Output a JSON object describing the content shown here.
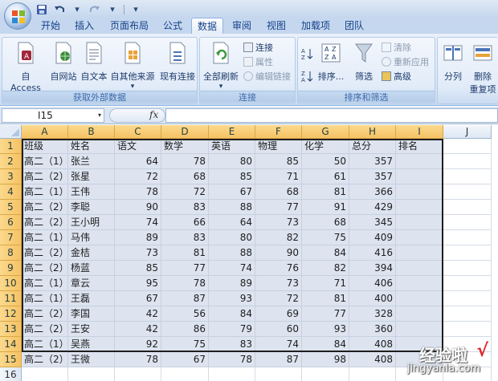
{
  "quick_access": {
    "separator": "|",
    "dropdown": "▾"
  },
  "tabs": [
    {
      "label": "开始",
      "active": false
    },
    {
      "label": "插入",
      "active": false
    },
    {
      "label": "页面布局",
      "active": false
    },
    {
      "label": "公式",
      "active": false
    },
    {
      "label": "数据",
      "active": true
    },
    {
      "label": "审阅",
      "active": false
    },
    {
      "label": "视图",
      "active": false
    },
    {
      "label": "加载项",
      "active": false
    },
    {
      "label": "团队",
      "active": false
    }
  ],
  "ribbon": {
    "external_group": {
      "label": "获取外部数据",
      "buttons": [
        "自 Access",
        "自网站",
        "自文本",
        "自其他来源",
        "现有连接"
      ]
    },
    "connections_group": {
      "label": "连接",
      "refresh": "全部刷新",
      "connections": "连接",
      "properties": "属性",
      "edit_links": "编辑链接"
    },
    "sort_group": {
      "label": "排序和筛选",
      "sort": "排序...",
      "filter": "筛选",
      "clear": "清除",
      "reapply": "重新应用",
      "advanced": "高级"
    },
    "tools_group": {
      "split": "分列",
      "remove_dup_1": "删除",
      "remove_dup_2": "重复项"
    }
  },
  "formula_bar": {
    "name_box": "I15",
    "fx": "fx",
    "content": ""
  },
  "sheet": {
    "columns": [
      "A",
      "B",
      "C",
      "D",
      "E",
      "F",
      "G",
      "H",
      "I",
      "J"
    ],
    "rows": [
      "1",
      "2",
      "3",
      "4",
      "5",
      "6",
      "7",
      "8",
      "9",
      "10",
      "11",
      "12",
      "13",
      "14",
      "15",
      "16"
    ],
    "headers": [
      "班级",
      "姓名",
      "语文",
      "数学",
      "英语",
      "物理",
      "化学",
      "总分",
      "排名"
    ],
    "records": [
      [
        "高二（1）",
        "张兰",
        "64",
        "78",
        "80",
        "85",
        "50",
        "357",
        ""
      ],
      [
        "高二（2）",
        "张星",
        "72",
        "68",
        "85",
        "71",
        "61",
        "357",
        ""
      ],
      [
        "高二（1）",
        "王伟",
        "78",
        "72",
        "67",
        "68",
        "81",
        "366",
        ""
      ],
      [
        "高二（2）",
        "李聪",
        "90",
        "83",
        "88",
        "77",
        "91",
        "429",
        ""
      ],
      [
        "高二（2）",
        "王小明",
        "74",
        "66",
        "64",
        "73",
        "68",
        "345",
        ""
      ],
      [
        "高二（1）",
        "马伟",
        "89",
        "83",
        "80",
        "82",
        "75",
        "409",
        ""
      ],
      [
        "高二（2）",
        "金桔",
        "73",
        "81",
        "88",
        "90",
        "84",
        "416",
        ""
      ],
      [
        "高二（2）",
        "杨蓝",
        "85",
        "77",
        "74",
        "76",
        "82",
        "394",
        ""
      ],
      [
        "高二（1）",
        "章云",
        "95",
        "78",
        "89",
        "73",
        "71",
        "406",
        ""
      ],
      [
        "高二（1）",
        "王磊",
        "67",
        "87",
        "93",
        "72",
        "81",
        "400",
        ""
      ],
      [
        "高二（2）",
        "李国",
        "42",
        "56",
        "84",
        "69",
        "77",
        "328",
        ""
      ],
      [
        "高二（2）",
        "王安",
        "42",
        "86",
        "79",
        "60",
        "93",
        "360",
        ""
      ],
      [
        "高二（1）",
        "吴燕",
        "92",
        "75",
        "83",
        "74",
        "84",
        "408",
        ""
      ],
      [
        "高二（2）",
        "王微",
        "78",
        "67",
        "78",
        "87",
        "98",
        "408",
        ""
      ]
    ]
  },
  "watermark": {
    "line1": "经验啦",
    "check": "√",
    "line2": "jingyanla.com"
  },
  "colors": {
    "accent": "#15428b",
    "header_highlight": "#f6c264",
    "selection": "#dde4f0"
  }
}
